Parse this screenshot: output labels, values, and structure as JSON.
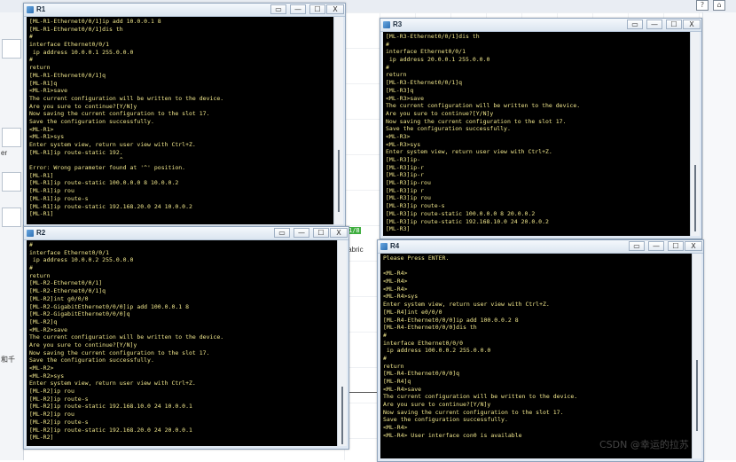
{
  "background": {
    "labels": {
      "tr_pointer": "er",
      "cn_text": "和千",
      "link_label": "fabric"
    },
    "badges": [
      "1/8"
    ]
  },
  "windows": [
    {
      "id": "R1",
      "title": "R1",
      "lines": [
        "[ML-R1-Ethernet0/0/1]ip add 10.0.0.1 8",
        "[ML-R1-Ethernet0/0/1]dis th",
        "#",
        "interface Ethernet0/0/1",
        " ip address 10.0.0.1 255.0.0.0",
        "#",
        "return",
        "[ML-R1-Ethernet0/0/1]q",
        "[ML-R1]q",
        "<ML-R1>save",
        "The current configuration will be written to the device.",
        "Are you sure to continue?[Y/N]y",
        "Now saving the current configuration to the slot 17.",
        "Save the configuration successfully.",
        "<ML-R1>",
        "<ML-R1>sys",
        "Enter system view, return user view with Ctrl+Z.",
        "[ML-R1]ip route-static 192.",
        "                          ^",
        "Error: Wrong parameter found at '^' position.",
        "[ML-R1]",
        "[ML-R1]ip route-static 100.0.0.0 8 10.0.0.2",
        "[ML-R1]ip rou",
        "[ML-R1]ip route-s",
        "[ML-R1]ip route-static 192.168.20.0 24 10.0.0.2",
        "[ML-R1]"
      ]
    },
    {
      "id": "R2",
      "title": "R2",
      "lines": [
        "#",
        "interface Ethernet0/0/1",
        " ip address 10.0.0.2 255.0.0.0",
        "#",
        "return",
        "[ML-R2-Ethernet0/0/1]",
        "[ML-R2-Ethernet0/0/1]q",
        "[ML-R2]int g0/0/0",
        "[ML-R2-GigabitEthernet0/0/0]ip add 100.0.0.1 8",
        "[ML-R2-GigabitEthernet0/0/0]q",
        "[ML-R2]q",
        "<ML-R2>save",
        "The current configuration will be written to the device.",
        "Are you sure to continue?[Y/N]y",
        "Now saving the current configuration to the slot 17.",
        "Save the configuration successfully.",
        "<ML-R2>",
        "<ML-R2>sys",
        "Enter system view, return user view with Ctrl+Z.",
        "[ML-R2]ip rou",
        "[ML-R2]ip route-s",
        "[ML-R2]ip route-static 192.168.10.0 24 10.0.0.1",
        "[ML-R2]ip rou",
        "[ML-R2]ip route-s",
        "[ML-R2]ip route-static 192.168.20.0 24 20.0.0.1",
        "[ML-R2]"
      ]
    },
    {
      "id": "R3",
      "title": "R3",
      "lines": [
        "[ML-R3-Ethernet0/0/1]dis th",
        "#",
        "interface Ethernet0/0/1",
        " ip address 20.0.0.1 255.0.0.0",
        "#",
        "return",
        "[ML-R3-Ethernet0/0/1]q",
        "[ML-R3]q",
        "<ML-R3>save",
        "The current configuration will be written to the device.",
        "Are you sure to continue?[Y/N]y",
        "Now saving the current configuration to the slot 17.",
        "Save the configuration successfully.",
        "<ML-R3>",
        "<ML-R3>sys",
        "Enter system view, return user view with Ctrl+Z.",
        "[ML-R3]ip-",
        "[ML-R3]ip-r",
        "[ML-R3]ip-r",
        "[ML-R3]ip-rou",
        "[ML-R3]ip r",
        "[ML-R3]ip rou",
        "[ML-R3]ip route-s",
        "[ML-R3]ip route-static 100.0.0.0 8 20.0.0.2",
        "[ML-R3]ip route-static 192.168.10.0 24 20.0.0.2",
        "[ML-R3]"
      ]
    },
    {
      "id": "R4",
      "title": "R4",
      "lines": [
        "Please Press ENTER.",
        "",
        "<ML-R4>",
        "<ML-R4>",
        "<ML-R4>",
        "<ML-R4>sys",
        "Enter system view, return user view with Ctrl+Z.",
        "[ML-R4]int e0/0/0",
        "[ML-R4-Ethernet0/0/0]ip add 100.0.0.2 8",
        "[ML-R4-Ethernet0/0/0]dis th",
        "#",
        "interface Ethernet0/0/0",
        " ip address 100.0.0.2 255.0.0.0",
        "#",
        "return",
        "[ML-R4-Ethernet0/0/0]q",
        "[ML-R4]q",
        "<ML-R4>save",
        "The current configuration will be written to the device.",
        "Are you sure to continue?[Y/N]y",
        "Now saving the current configuration to the slot 17.",
        "Save the configuration successfully.",
        "<ML-R4>",
        "<ML-R4> User interface con0 is available"
      ]
    }
  ],
  "window_buttons": {
    "restore": "▭",
    "minimize": "—",
    "maximize": "☐",
    "close": "X"
  },
  "watermark": "CSDN @幸运的拉苏"
}
